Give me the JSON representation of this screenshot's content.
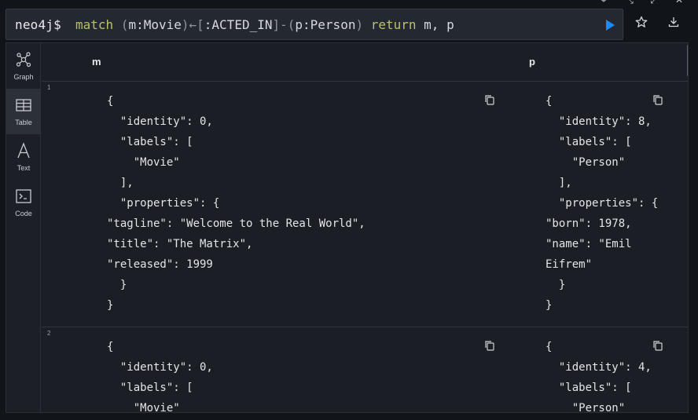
{
  "window_controls": [
    "pin-icon",
    "collapse-icon",
    "fullscreen-icon",
    "close-icon"
  ],
  "editor": {
    "prompt": "neo4j$",
    "query": {
      "kw_match": "match",
      "p1": " (",
      "node1": "m:Movie",
      "p2": ")←[",
      "rel": ":ACTED_IN",
      "p3": "]-(",
      "node2": "p:Person",
      "p4": ")",
      "kw_return": "return",
      "vars": " m, p"
    }
  },
  "toolbar": {
    "run_icon": "play-icon",
    "favorite_icon": "star-icon",
    "download_icon": "download-icon"
  },
  "sidenav": {
    "items": [
      {
        "label": "Graph",
        "icon": "graph-icon"
      },
      {
        "label": "Table",
        "icon": "table-icon"
      },
      {
        "label": "Text",
        "icon": "text-icon"
      },
      {
        "label": "Code",
        "icon": "code-icon"
      }
    ],
    "active": "Table"
  },
  "table": {
    "columns": [
      "m",
      "p"
    ],
    "rows": [
      {
        "num": "1",
        "m": "{\n  \"identity\": 0,\n  \"labels\": [\n    \"Movie\"\n  ],\n  \"properties\": {\n\"tagline\": \"Welcome to the Real World\",\n\"title\": \"The Matrix\",\n\"released\": 1999\n  }\n}",
        "p": "{\n  \"identity\": 8,\n  \"labels\": [\n    \"Person\"\n  ],\n  \"properties\": {\n\"born\": 1978,\n\"name\": \"Emil\nEifrem\"\n  }\n}"
      },
      {
        "num": "2",
        "m": "{\n  \"identity\": 0,\n  \"labels\": [\n    \"Movie\"",
        "p": "{\n  \"identity\": 4,\n  \"labels\": [\n    \"Person\""
      }
    ],
    "copy_icon": "copy-icon"
  }
}
